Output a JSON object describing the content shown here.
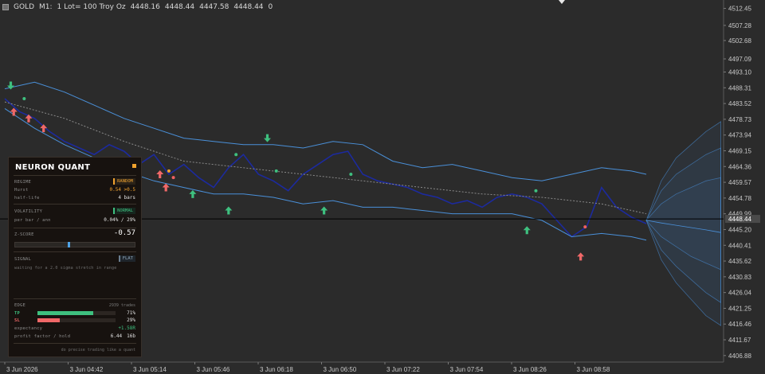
{
  "header": {
    "symbol": "GOLD",
    "timeframe": "M1:",
    "lot": "1 Lot= 100 Troy Oz",
    "open": "4448.16",
    "high": "4448.44",
    "low": "4447.58",
    "close": "4448.44",
    "tick_volume": "0"
  },
  "current_price_label": "4448.44",
  "chart_data": {
    "type": "line",
    "title": "",
    "y_ticks": [
      "4512.45",
      "4507.28",
      "4502.68",
      "4497.09",
      "4493.10",
      "4488.31",
      "4483.52",
      "4478.73",
      "4473.94",
      "4469.15",
      "4464.36",
      "4459.57",
      "4454.78",
      "4449.99",
      "4445.20",
      "4440.41",
      "4435.62",
      "4430.83",
      "4426.04",
      "4421.25",
      "4416.46",
      "4411.67",
      "4406.88"
    ],
    "x_ticks": [
      "3 Jun 2026",
      "3 Jun 04:42",
      "3 Jun 05:14",
      "3 Jun 05:46",
      "3 Jun 06:18",
      "3 Jun 06:50",
      "3 Jun 07:22",
      "3 Jun 07:54",
      "3 Jun 08:26",
      "3 Jun 08:58"
    ],
    "ylim": [
      4404.9,
      4515.0
    ],
    "xlim": [
      0,
      48.5
    ],
    "last_price": 4448.44,
    "series": [
      {
        "name": "",
        "role": "price",
        "color": "#1c2a9e",
        "x": [
          0,
          1,
          2,
          3,
          4,
          5,
          6,
          7,
          8,
          9,
          10,
          11,
          12,
          13,
          14,
          15,
          16,
          17,
          18,
          19,
          20,
          21,
          22,
          23,
          24,
          25,
          26,
          27,
          28,
          29,
          30,
          31,
          32,
          33,
          34,
          35,
          36,
          37,
          38,
          39,
          40,
          41,
          42,
          43
        ],
        "y": [
          4485,
          4481,
          4479,
          4475,
          4472,
          4470,
          4468,
          4471,
          4469,
          4465,
          4468,
          4462,
          4465,
          4461,
          4458,
          4464,
          4468,
          4462,
          4460,
          4457,
          4462,
          4465,
          4468,
          4469,
          4462,
          4460,
          4459,
          4458,
          4456,
          4455,
          4453,
          4454,
          4452,
          4455,
          4456,
          4455,
          4453,
          4448,
          4443,
          4446,
          4458,
          4452,
          4449,
          4447
        ]
      },
      {
        "name": "",
        "role": "upper-band",
        "color": "#4a90d9",
        "x": [
          0,
          2,
          4,
          6,
          8,
          10,
          12,
          14,
          16,
          18,
          20,
          22,
          24,
          26,
          28,
          30,
          32,
          34,
          36,
          38,
          40,
          42,
          43
        ],
        "y": [
          4488,
          4490,
          4487,
          4483,
          4479,
          4476,
          4473,
          4472,
          4471,
          4471,
          4470,
          4472,
          4471,
          4466,
          4464,
          4465,
          4463,
          4461,
          4460,
          4462,
          4464,
          4463,
          4462
        ]
      },
      {
        "name": "",
        "role": "lower-band",
        "color": "#4a90d9",
        "x": [
          0,
          2,
          4,
          6,
          8,
          10,
          12,
          14,
          16,
          18,
          20,
          22,
          24,
          26,
          28,
          30,
          32,
          34,
          36,
          38,
          40,
          42,
          43
        ],
        "y": [
          4482,
          4476,
          4471,
          4467,
          4463,
          4460,
          4458,
          4456,
          4456,
          4455,
          4453,
          4454,
          4452,
          4452,
          4451,
          4450,
          4450,
          4450,
          4448,
          4443,
          4444,
          4443,
          4442
        ]
      },
      {
        "name": "",
        "role": "basis",
        "color": "#8a8a8a",
        "x": [
          0,
          4,
          8,
          12,
          16,
          20,
          24,
          28,
          32,
          36,
          40,
          43
        ],
        "y": [
          4484,
          4479,
          4472,
          4466,
          4464,
          4462,
          4460,
          4458,
          4456,
          4455,
          4453,
          4450
        ]
      }
    ],
    "projection": {
      "color": "#4a90d9",
      "x": [
        43,
        44,
        45,
        46,
        47,
        48
      ],
      "center": [
        4448,
        4447.2,
        4446.5,
        4445.8,
        4445.1,
        4444.3
      ],
      "bands": [
        {
          "upper": [
            4448,
            4453,
            4456,
            4458,
            4460,
            4461
          ],
          "lower": [
            4448,
            4443,
            4440,
            4437,
            4435,
            4433
          ]
        },
        {
          "upper": [
            4448,
            4457,
            4462,
            4465,
            4468,
            4470
          ],
          "lower": [
            4448,
            4439,
            4434,
            4430,
            4426,
            4423
          ]
        },
        {
          "upper": [
            4448,
            4460,
            4467,
            4471,
            4475,
            4478
          ],
          "lower": [
            4448,
            4436,
            4429,
            4424,
            4419,
            4416
          ]
        }
      ]
    },
    "signals": [
      {
        "x": 0.4,
        "y": 4489,
        "dir": "down"
      },
      {
        "x": 0.6,
        "y": 4481,
        "dir": "up"
      },
      {
        "x": 1.6,
        "y": 4479,
        "dir": "up"
      },
      {
        "x": 2.6,
        "y": 4476,
        "dir": "up"
      },
      {
        "x": 10.4,
        "y": 4462,
        "dir": "up"
      },
      {
        "x": 10.8,
        "y": 4458,
        "dir": "up"
      },
      {
        "x": 12.6,
        "y": 4456,
        "dir": "up"
      },
      {
        "x": 15.0,
        "y": 4451,
        "dir": "up"
      },
      {
        "x": 17.6,
        "y": 4473,
        "dir": "down"
      },
      {
        "x": 21.4,
        "y": 4451,
        "dir": "up"
      },
      {
        "x": 35.0,
        "y": 4445,
        "dir": "up"
      },
      {
        "x": 38.6,
        "y": 4437,
        "dir": "up"
      }
    ],
    "dots": [
      {
        "x": 1.3,
        "y": 4485,
        "color": "#3ec07f"
      },
      {
        "x": 11.3,
        "y": 4461,
        "color": "#f06060"
      },
      {
        "x": 11.0,
        "y": 4463,
        "color": "#f0a22e"
      },
      {
        "x": 15.5,
        "y": 4468,
        "color": "#3ec07f"
      },
      {
        "x": 18.2,
        "y": 4463,
        "color": "#3ec07f"
      },
      {
        "x": 23.2,
        "y": 4462,
        "color": "#3ec07f"
      },
      {
        "x": 35.6,
        "y": 4457,
        "color": "#3ec07f"
      },
      {
        "x": 38.9,
        "y": 4446,
        "color": "#f06060"
      }
    ]
  },
  "colors": {
    "background": "#2b2b2b",
    "axis_text": "#c8c8c8",
    "up_signal": "#3ec07f",
    "down_signal": "#f06868",
    "accent": "#f0a22e"
  },
  "panel": {
    "title": "NEURON QUANT",
    "regime": {
      "section": "REGIME",
      "tag": "RANDOM",
      "hurst_label": "Hurst",
      "hurst_value": "0.54 >0.5",
      "halflife_label": "half-life",
      "halflife_value": "4 bars"
    },
    "volatility": {
      "section": "VOLATILITY",
      "tag": "NORMAL",
      "label": "per bar / ann",
      "value": "0.04% / 29%"
    },
    "zscore": {
      "section": "Z-SCORE",
      "value": "-0.57",
      "position": 0.44
    },
    "signal": {
      "section": "SIGNAL",
      "tag": "FLAT",
      "note": "waiting for a 2.0 sigma stretch in range"
    },
    "edge": {
      "section": "EDGE",
      "trades": "2939 trades",
      "tp_label": "TP",
      "tp_pct": "71%",
      "tp_fraction": 0.71,
      "sl_label": "SL",
      "sl_pct": "29%",
      "sl_fraction": 0.29,
      "expectancy_label": "expectancy",
      "expectancy_value": "+1.58R",
      "pf_label": "profit factor / hold",
      "pf_value": "6.44",
      "hold_value": "16b"
    },
    "footer": "do precise trading like a quant"
  }
}
